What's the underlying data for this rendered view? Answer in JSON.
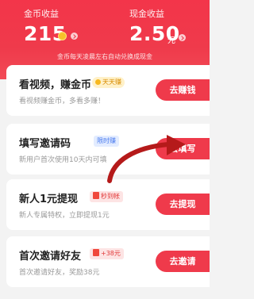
{
  "header": {
    "coin_label": "金币收益",
    "coin_value": "215",
    "cash_label": "现金收益",
    "cash_value": "2.50",
    "cash_unit": "元",
    "note": "金币每天凌晨左右自动兑换成现金"
  },
  "tasks": [
    {
      "title": "看视频，赚金币",
      "badge": "天天赚",
      "subtitle": "看视频赚金币，多看多赚！",
      "button": "去赚钱"
    },
    {
      "title": "填写邀请码",
      "badge": "限时赚",
      "subtitle": "新用户首次使用10天内可填",
      "button": "去填写"
    },
    {
      "title": "新人1元提现",
      "badge": "秒到帐",
      "subtitle": "新人专属特权，立即提现1元",
      "button": "去提现"
    },
    {
      "title": "首次邀请好友",
      "badge": "+38元",
      "subtitle": "首次邀请好友，奖励38元",
      "button": "去邀请"
    }
  ],
  "colors": {
    "accent": "#ef3a4b",
    "coin": "#f7c02a"
  },
  "icons": [
    "coin-icon",
    "chevron-right-icon",
    "red-envelope-icon",
    "arrow-annotation-icon"
  ]
}
